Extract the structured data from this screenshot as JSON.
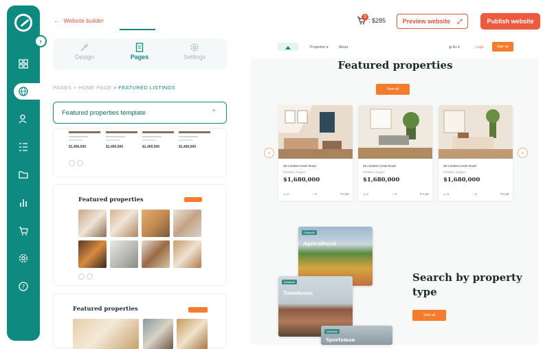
{
  "sidebar": {
    "items": [
      "home-icon",
      "globe-icon",
      "users-icon",
      "list-icon",
      "folder-icon",
      "chart-icon",
      "cart-icon",
      "settings-icon",
      "help-icon"
    ],
    "active": "globe-icon",
    "accent": "#0f8a80"
  },
  "header": {
    "back_label": "Website builder",
    "cart_badge": "3",
    "cart_amount": ": $285",
    "preview_label": "Preview website",
    "publish_label": "Publish website"
  },
  "tabs": [
    {
      "label": "Design",
      "icon": "brush-icon"
    },
    {
      "label": "Pages",
      "icon": "page-icon",
      "active": true
    },
    {
      "label": "Settings",
      "icon": "gear-icon"
    }
  ],
  "breadcrumb": {
    "items": [
      "PAGES",
      "HOME PAGE",
      "FEATURED LISTINGS"
    ],
    "separator": ">"
  },
  "template_select": {
    "value": "Featured properties template"
  },
  "templates": {
    "card2_title": "Featured properties",
    "card3_title": "Featured properties",
    "mini_prices": [
      "$1,400,000",
      "$1,400,000",
      "$1,400,000",
      "$1,400,000"
    ]
  },
  "preview": {
    "nav": {
      "links": [
        "Properties",
        "About"
      ],
      "lang": "En",
      "login": "Login",
      "signup": "Sign up"
    },
    "section_title": "Featured properties",
    "view_all": "View all",
    "listings": [
      {
        "address": "25 Coolest Creek Road",
        "sub": "Portland, Oregon",
        "price": "$1,680,000",
        "beds": "3",
        "baths": "2",
        "area": "2.3K"
      },
      {
        "address": "25 Coolest Creek Road",
        "sub": "Portland, Oregon",
        "price": "$1,680,000",
        "beds": "4",
        "baths": "3",
        "area": "1.1K"
      },
      {
        "address": "25 Coolest Creek Road",
        "sub": "Portland, Oregon",
        "price": "$1,680,000",
        "beds": "3",
        "baths": "2",
        "area": "2.3K"
      }
    ],
    "property_types": [
      {
        "tag": "Verkaufe",
        "label": "Agricultural"
      },
      {
        "tag": "Verkaufe",
        "label": "Townhouse"
      },
      {
        "tag": "Verkaufe",
        "label": "Sportsman"
      }
    ],
    "search_title": "Search by property type",
    "view_all_2": "View all"
  }
}
